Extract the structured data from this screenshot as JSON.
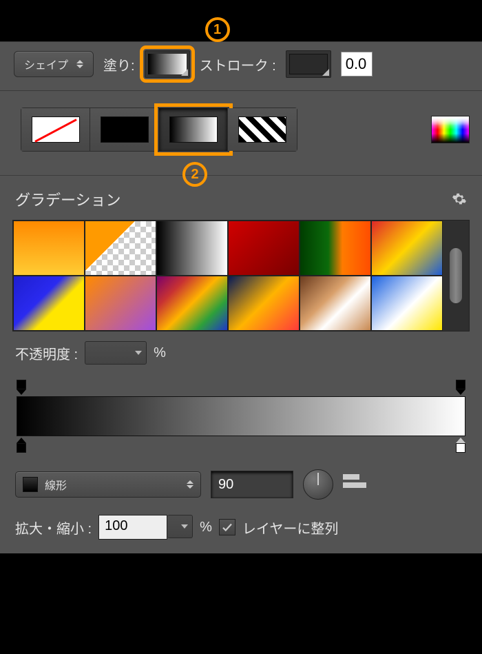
{
  "optionsBar": {
    "toolMode": "シェイプ",
    "fillLabel": "塗り:",
    "strokeLabel": "ストローク :",
    "strokeWidth": "0.0"
  },
  "annotations": {
    "badge1": "1",
    "badge2": "2"
  },
  "fillTypes": {
    "none": "none",
    "solid": "solid",
    "gradient": "gradient",
    "pattern": "pattern"
  },
  "gradientPanel": {
    "title": "グラデーション",
    "opacityLabel": "不透明度 :",
    "opacityValue": "",
    "percent": "%",
    "typeLabel": "線形",
    "angle": "90",
    "scaleLabel": "拡大・縮小 :",
    "scaleValue": "100",
    "alignLabel": "レイヤーに整列"
  }
}
